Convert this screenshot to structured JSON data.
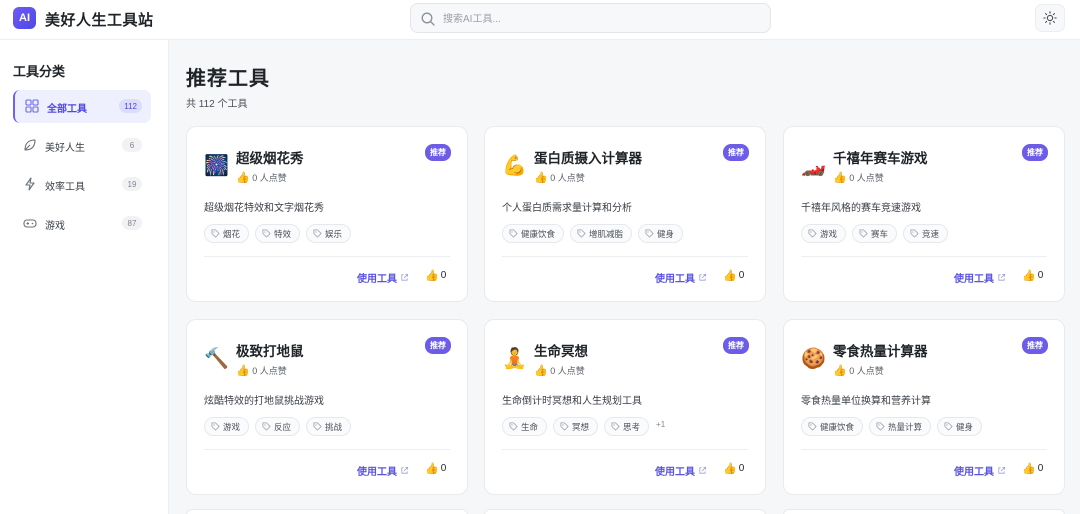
{
  "header": {
    "logo_text": "AI",
    "site_title": "美好人生工具站",
    "search_placeholder": "搜索AI工具...",
    "theme_icon": "sun-icon"
  },
  "sidebar": {
    "title": "工具分类",
    "categories": [
      {
        "label": "全部工具",
        "count": "112",
        "icon": "grid-icon",
        "active": true
      },
      {
        "label": "美好人生",
        "count": "6",
        "icon": "leaf-icon",
        "active": false
      },
      {
        "label": "效率工具",
        "count": "19",
        "icon": "lightning-icon",
        "active": false
      },
      {
        "label": "游戏",
        "count": "87",
        "icon": "gamepad-icon",
        "active": false
      }
    ]
  },
  "main": {
    "title": "推荐工具",
    "subtitle": "共 112 个工具",
    "cards": [
      {
        "emoji": "🎆",
        "name": "超级烟花秀",
        "likes": "0 人点赞",
        "badge": "推荐",
        "desc": "超级烟花特效和文字烟花秀",
        "tags": [
          "烟花",
          "特效",
          "娱乐"
        ],
        "more": "",
        "use": "使用工具",
        "votes": "0"
      },
      {
        "emoji": "💪",
        "name": "蛋白质摄入计算器",
        "likes": "0 人点赞",
        "badge": "推荐",
        "desc": "个人蛋白质需求量计算和分析",
        "tags": [
          "健康饮食",
          "增肌减脂",
          "健身"
        ],
        "more": "",
        "use": "使用工具",
        "votes": "0"
      },
      {
        "emoji": "🏎️",
        "name": "千禧年赛车游戏",
        "likes": "0 人点赞",
        "badge": "推荐",
        "desc": "千禧年风格的赛车竞速游戏",
        "tags": [
          "游戏",
          "赛车",
          "竞速"
        ],
        "more": "",
        "use": "使用工具",
        "votes": "0"
      },
      {
        "emoji": "🔨",
        "name": "极致打地鼠",
        "likes": "0 人点赞",
        "badge": "推荐",
        "desc": "炫酷特效的打地鼠挑战游戏",
        "tags": [
          "游戏",
          "反应",
          "挑战"
        ],
        "more": "",
        "use": "使用工具",
        "votes": "0"
      },
      {
        "emoji": "🧘",
        "name": "生命冥想",
        "likes": "0 人点赞",
        "badge": "推荐",
        "desc": "生命倒计时冥想和人生规划工具",
        "tags": [
          "生命",
          "冥想",
          "思考"
        ],
        "more": "+1",
        "use": "使用工具",
        "votes": "0"
      },
      {
        "emoji": "🍪",
        "name": "零食热量计算器",
        "likes": "0 人点赞",
        "badge": "推荐",
        "desc": "零食热量单位换算和营养计算",
        "tags": [
          "健康饮食",
          "热量计算",
          "健身"
        ],
        "more": "",
        "use": "使用工具",
        "votes": "0"
      }
    ]
  }
}
